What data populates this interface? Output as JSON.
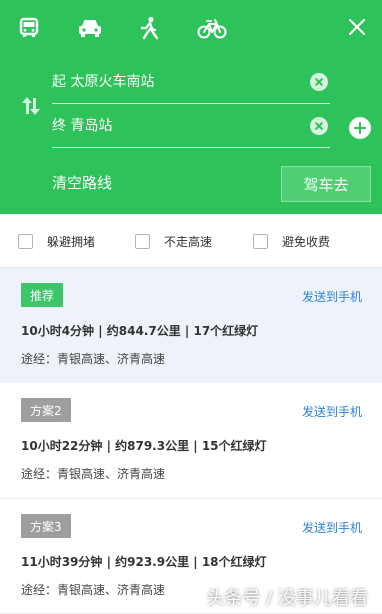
{
  "modes": [
    {
      "name": "bus-icon"
    },
    {
      "name": "car-icon"
    },
    {
      "name": "walk-icon"
    },
    {
      "name": "bike-icon"
    }
  ],
  "route": {
    "start_label": "起  太原火车南站",
    "end_label": "终  青岛站",
    "clear_route": "清空路线",
    "go_button": "驾车去"
  },
  "options": [
    {
      "label": "躲避拥堵"
    },
    {
      "label": "不走高速"
    },
    {
      "label": "避免收费"
    }
  ],
  "plans": [
    {
      "tag": "推荐",
      "send": "发送到手机",
      "summary": "10小时4分钟 | 约844.7公里 | 17个红绿灯",
      "via": "途经：青银高速、济青高速"
    },
    {
      "tag": "方案2",
      "send": "发送到手机",
      "summary": "10小时22分钟 | 约879.3公里 | 15个红绿灯",
      "via": "途经：青银高速、济青高速"
    },
    {
      "tag": "方案3",
      "send": "发送到手机",
      "summary": "11小时39分钟 | 约923.9公里 | 18个红绿灯",
      "via": "途经：青银高速、济青高速"
    }
  ],
  "watermark": "头条号 / 没事儿看看",
  "colors": {
    "header_green": "#2dc25a",
    "recommend_tag": "#3cc569",
    "alt_tag": "#9e9e9e",
    "link_blue": "#2d83d8",
    "selected_row_bg": "#eef2fa"
  }
}
